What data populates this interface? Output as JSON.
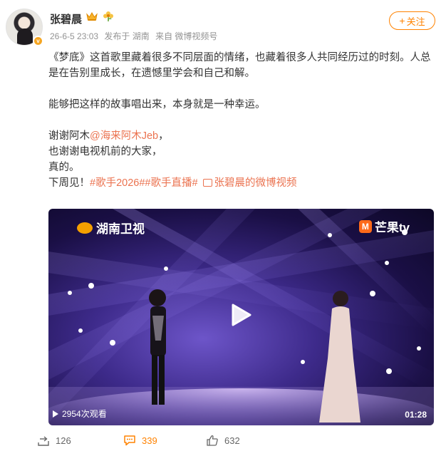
{
  "user": {
    "name": "张碧晨",
    "verified_badge": "v",
    "time": "26-6-5 23:03",
    "location": "发布于 湖南",
    "source": "来自 微博视频号"
  },
  "follow": {
    "plus": "+",
    "label": "关注"
  },
  "post": {
    "para1": "《梦底》这首歌里藏着很多不同层面的情绪，也藏着很多人共同经历过的时刻。人总是在告别里成长，在遗憾里学会和自己和解。",
    "para2": "能够把这样的故事唱出来，本身就是一种幸运。",
    "line3_prefix": "谢谢阿木",
    "mention": "@海来阿木Jeb",
    "line3_suffix": "，",
    "line4": "也谢谢电视机前的大家，",
    "line5": "真的。",
    "line6_prefix": "下周见！",
    "hashtag1": "#歌手2026#",
    "hashtag2": "#歌手直播#",
    "video_link": "张碧晨的微博视频"
  },
  "video": {
    "logo_left": "湖南卫视",
    "logo_right": "芒果tv",
    "logo_right_mark": "M",
    "views": "2954次观看",
    "duration": "01:28"
  },
  "actions": {
    "repost": "126",
    "comment": "339",
    "like": "632"
  },
  "colors": {
    "accent": "#ff8200",
    "link": "#eb7350",
    "meta": "#939393"
  },
  "icons": [
    "crown-icon",
    "flower-icon",
    "play-icon",
    "repost-icon",
    "comment-icon",
    "like-icon",
    "video-link-icon"
  ]
}
